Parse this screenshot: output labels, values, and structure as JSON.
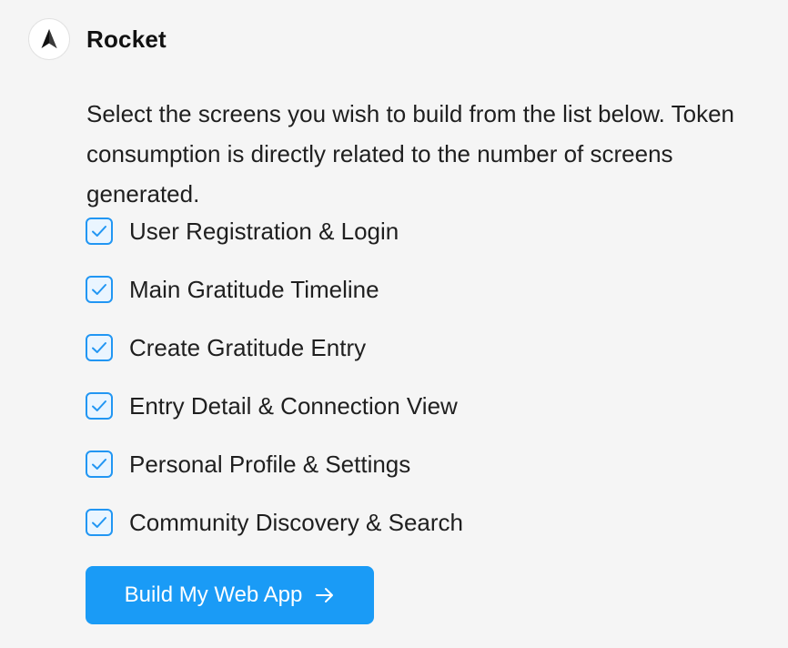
{
  "assistant": {
    "name": "Rocket",
    "icon": "rocket-logo-icon"
  },
  "message": {
    "text": "Select the screens you wish to build from the list below. Token consumption is directly related to the number of screens generated."
  },
  "screens": [
    {
      "label": "User Registration & Login",
      "checked": true
    },
    {
      "label": "Main Gratitude Timeline",
      "checked": true
    },
    {
      "label": "Create Gratitude Entry",
      "checked": true
    },
    {
      "label": "Entry Detail & Connection View",
      "checked": true
    },
    {
      "label": "Personal Profile & Settings",
      "checked": true
    },
    {
      "label": "Community Discovery & Search",
      "checked": true
    }
  ],
  "build_button": {
    "label": "Build My Web App",
    "icon": "arrow-right-icon"
  },
  "colors": {
    "accent": "#1a9bf6",
    "checkbox_border": "#2196f3",
    "background": "#f5f5f5"
  }
}
